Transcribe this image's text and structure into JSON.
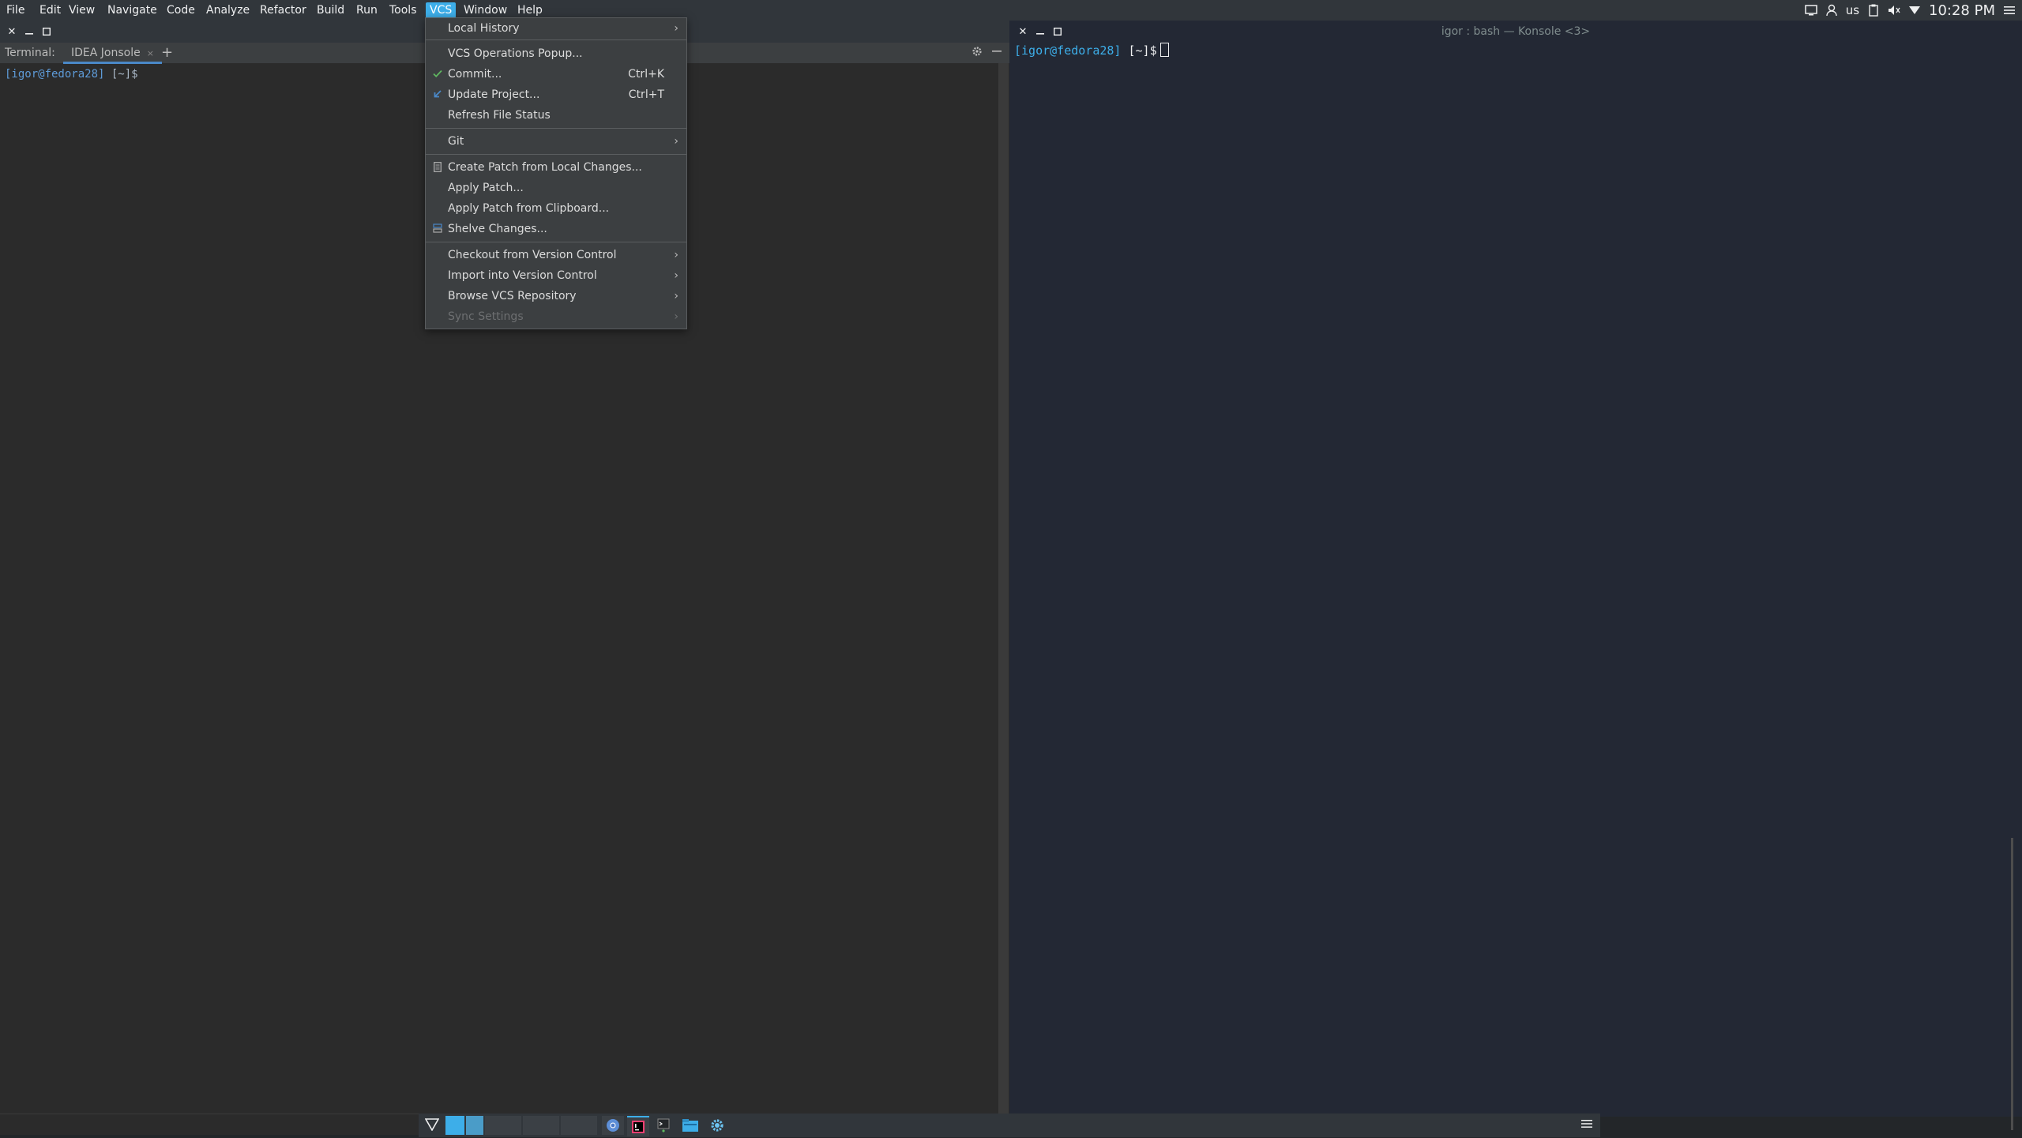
{
  "menubar": {
    "items": [
      "File",
      "Edit",
      "View",
      "Navigate",
      "Code",
      "Analyze",
      "Refactor",
      "Build",
      "Run",
      "Tools",
      "VCS",
      "Window",
      "Help"
    ],
    "active": "VCS"
  },
  "tray": {
    "keyboard_layout": "us",
    "clock": "10:28 PM",
    "icons": [
      "screen-icon",
      "user-icon",
      "keyboard-layout",
      "clipboard-icon",
      "volume-icon",
      "network-icon",
      "menu-icon"
    ]
  },
  "left_window": {
    "tool_label": "Terminal:",
    "tab_label": "IDEA Jonsole",
    "tab_close": "×",
    "new_tab": "+",
    "prompt_user": "[igor@fedora28]",
    "prompt_rest": " [~]$"
  },
  "right_window": {
    "title": "igor : bash — Konsole <3>",
    "prompt_user": "[igor@fedora28]",
    "prompt_rest": " [~]$"
  },
  "vcs_menu": {
    "local_history": "Local History",
    "operations_popup": "VCS Operations Popup...",
    "commit": "Commit...",
    "commit_shortcut": "Ctrl+K",
    "update_project": "Update Project...",
    "update_shortcut": "Ctrl+T",
    "refresh_status": "Refresh File Status",
    "git": "Git",
    "create_patch": "Create Patch from Local Changes...",
    "apply_patch": "Apply Patch...",
    "apply_patch_clipboard": "Apply Patch from Clipboard...",
    "shelve_changes": "Shelve Changes...",
    "checkout": "Checkout from Version Control",
    "import": "Import into Version Control",
    "browse_repo": "Browse VCS Repository",
    "sync_settings": "Sync Settings"
  },
  "colors": {
    "accent": "#3daee9",
    "menu_bg": "#3c3f41",
    "commit_check": "#5fb760",
    "update_arrow": "#4a88c7"
  }
}
